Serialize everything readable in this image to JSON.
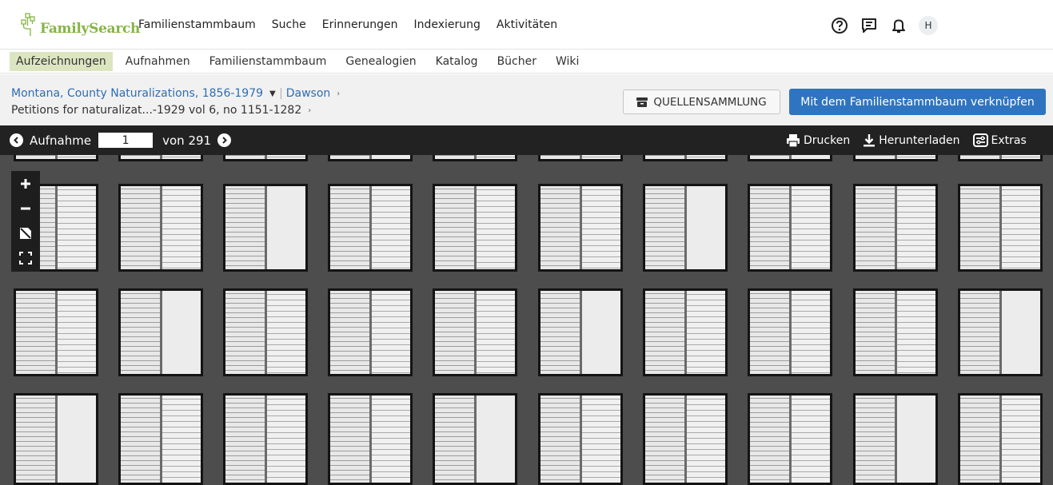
{
  "logo": {
    "text": "FamilySearch"
  },
  "main_nav": [
    "Familienstammbaum",
    "Suche",
    "Erinnerungen",
    "Indexierung",
    "Aktivitäten"
  ],
  "header_icons": [
    "help-icon",
    "messages-icon",
    "notifications-icon"
  ],
  "user": {
    "avatar_initial": "H"
  },
  "sub_nav": {
    "items": [
      "Aufzeichnungen",
      "Aufnahmen",
      "Familienstammbaum",
      "Genealogien",
      "Katalog",
      "Bücher",
      "Wiki"
    ],
    "active": "Aufzeichnungen"
  },
  "breadcrumb": {
    "collection": "Montana, County Naturalizations, 1856-1979",
    "county": "Dawson",
    "volume": "Petitions for naturalizat...-1929 vol 6, no 1151-1282"
  },
  "buttons": {
    "source_box": "QUELLENSAMMLUNG",
    "attach": "Mit dem Familienstammbaum verknüpfen"
  },
  "viewer": {
    "image_label": "Aufnahme",
    "current_image": "1",
    "of_total": "von 291",
    "actions": {
      "print": "Drucken",
      "download": "Herunterladen",
      "tools": "Extras"
    }
  },
  "zoom_controls": [
    "zoom-in-icon",
    "zoom-out-icon",
    "fit-icon",
    "fullscreen-icon"
  ],
  "colors": {
    "brand_green": "#86b545",
    "active_tab_bg": "#dbe6c1",
    "primary_blue": "#2f74c0",
    "link_blue": "#2f6db5",
    "viewer_bar": "#222222",
    "grid_bg": "#4d4d4d"
  }
}
